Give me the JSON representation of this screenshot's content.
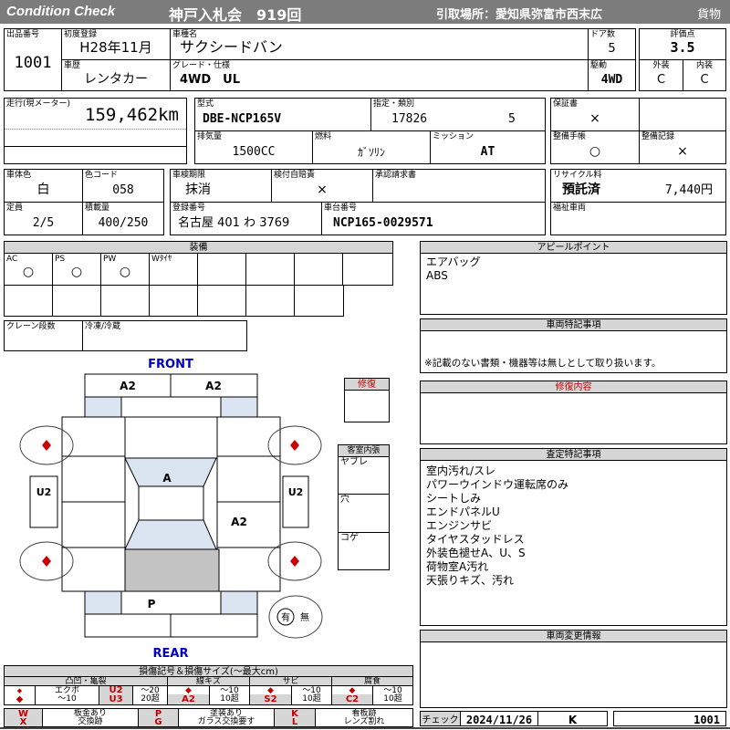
{
  "colors": {
    "header_bar": "#7c7c7c",
    "section_header_gray": "#d6d6d6",
    "accent_red": "#c00000",
    "front_rear_blue": "#0000c0",
    "panel_shade_blue": "#dbe5f1",
    "cargo_shade_gray": "#c3c3c3"
  },
  "header": {
    "brand": "Condition  Check",
    "auction": "神戸入札会　919回",
    "pickup": "引取場所：愛知県弥富市西末広",
    "category": "貨物"
  },
  "top": {
    "lot": {
      "label": "出品番号",
      "value": "1001"
    },
    "first_reg": {
      "label": "初度登録",
      "value": "H28年11月"
    },
    "history": {
      "label": "車歴",
      "value": "レンタカー"
    },
    "model": {
      "label": "車種名",
      "value": "サクシードバン"
    },
    "grade": {
      "label": "グレード・仕様",
      "value": "4WD　UL"
    },
    "doors": {
      "label": "ドア数",
      "value": "5"
    },
    "drive": {
      "label": "駆動",
      "value": "4WD"
    },
    "rating": {
      "label": "評価点",
      "value": "3.5"
    },
    "exterior": {
      "label": "外装",
      "value": "C"
    },
    "interior": {
      "label": "内装",
      "value": "C"
    }
  },
  "spec": {
    "mileage": {
      "label": "走行(現メーター)",
      "value": "159,462km"
    },
    "model_code": {
      "label": "型式",
      "value": "DBE-NCP165V"
    },
    "type_class": {
      "label": "指定・類別",
      "type_no": "17826",
      "class_no": "5"
    },
    "displacement": {
      "label": "排気量",
      "value": "1500CC"
    },
    "fuel": {
      "label": "燃料",
      "value": "ｶﾞｿﾘﾝ"
    },
    "mission": {
      "label": "ミッション",
      "value": "AT"
    },
    "warranty": {
      "label": "保証書",
      "value": "×"
    },
    "book": {
      "label": "整備手帳",
      "value": "○"
    },
    "record": {
      "label": "整備記録",
      "value": "×"
    }
  },
  "reg": {
    "body_color": {
      "label": "車体色",
      "value": "白"
    },
    "color_code": {
      "label": "色コード",
      "value": "058"
    },
    "inspection": {
      "label": "車検期限",
      "value": "抹消"
    },
    "jibaiseki": {
      "label": "検付自賠責",
      "value": "×"
    },
    "approval": {
      "label": "承認請求書"
    },
    "capacity": {
      "label": "定員",
      "value": "2/5"
    },
    "payload": {
      "label": "積載量",
      "value": "400/250"
    },
    "reg_no": {
      "label": "登録番号",
      "value": "名古屋  401  わ  3769"
    },
    "chassis": {
      "label": "車台番号",
      "value": "NCP165-0029571"
    },
    "recycle": {
      "label": "リサイクル料",
      "status": "預託済",
      "fee": "7,440円"
    },
    "welfare": {
      "label": "福祉車両"
    }
  },
  "equipment": {
    "title": "装備",
    "items": [
      {
        "label": "AC",
        "value": "○"
      },
      {
        "label": "PS",
        "value": "○"
      },
      {
        "label": "PW",
        "value": "○"
      },
      {
        "label": "Wﾀｲﾔ",
        "value": ""
      }
    ],
    "crane": {
      "label": "クレーン段数"
    },
    "reefer": {
      "label": "冷凍/冷蔵"
    }
  },
  "appeal": {
    "title": "アピールポイント",
    "lines": [
      "エアバッグ",
      "ABS"
    ]
  },
  "notes": {
    "title": "車両特記事項",
    "disclaimer": "※記載のない書類・機器等は無しとして取り扱います。"
  },
  "repair": {
    "title": "修復内容",
    "box_title": "修復"
  },
  "cabin": {
    "title": "客室内張",
    "rows": [
      "ヤブレ",
      "穴",
      "コゲ"
    ]
  },
  "assessment": {
    "title": "査定特記事項",
    "lines": [
      "室内汚れ/スレ",
      "パワーウインドウ運転席のみ",
      "シートしみ",
      "エンドパネルU",
      "エンジンサビ",
      "タイヤスタッドレス",
      "外装色褪せA、U、S",
      "荷物室A汚れ",
      "天張りキズ、汚れ"
    ]
  },
  "change": {
    "title": "車両変更情報"
  },
  "check": {
    "label": "チェック",
    "date": "2024/11/26",
    "inspector": "K",
    "lot": "1001"
  },
  "diagram": {
    "front": "FRONT",
    "rear": "REAR",
    "labels": {
      "bumper_fl": "A2",
      "bumper_fr": "A2",
      "side_l": "U2",
      "side_r": "U2",
      "windshield": "A",
      "quarter_r": "A2",
      "rear_panel": "P",
      "spare_yes": "有",
      "spare_no": "無"
    }
  },
  "legend": {
    "title": "損傷記号＆損傷サイズ(〜最大cm)",
    "groups": [
      {
        "name": "凸凹・亀裂",
        "r1": [
          "◆",
          "エクボ",
          "U2",
          "〜20"
        ],
        "r2": [
          "◆",
          "〜10",
          "U3",
          "20超"
        ]
      },
      {
        "name": "線キズ",
        "r1": [
          "◆",
          "〜10"
        ],
        "r2": [
          "A2",
          "10超"
        ]
      },
      {
        "name": "サビ",
        "r1": [
          "◆",
          "〜10"
        ],
        "r2": [
          "S2",
          "10超"
        ]
      },
      {
        "name": "腐食",
        "r1": [
          "◆",
          "〜10"
        ],
        "r2": [
          "C2",
          "10超"
        ]
      }
    ],
    "marks": [
      {
        "code": "W",
        "desc": "板金あり"
      },
      {
        "code": "X",
        "desc": "交換跡"
      },
      {
        "code": "P",
        "desc": "塗装あり"
      },
      {
        "code": "G",
        "desc": "ガラス交換要す"
      },
      {
        "code": "K",
        "desc": "看板跡"
      },
      {
        "code": "L",
        "desc": "レンズ割れ"
      }
    ]
  }
}
